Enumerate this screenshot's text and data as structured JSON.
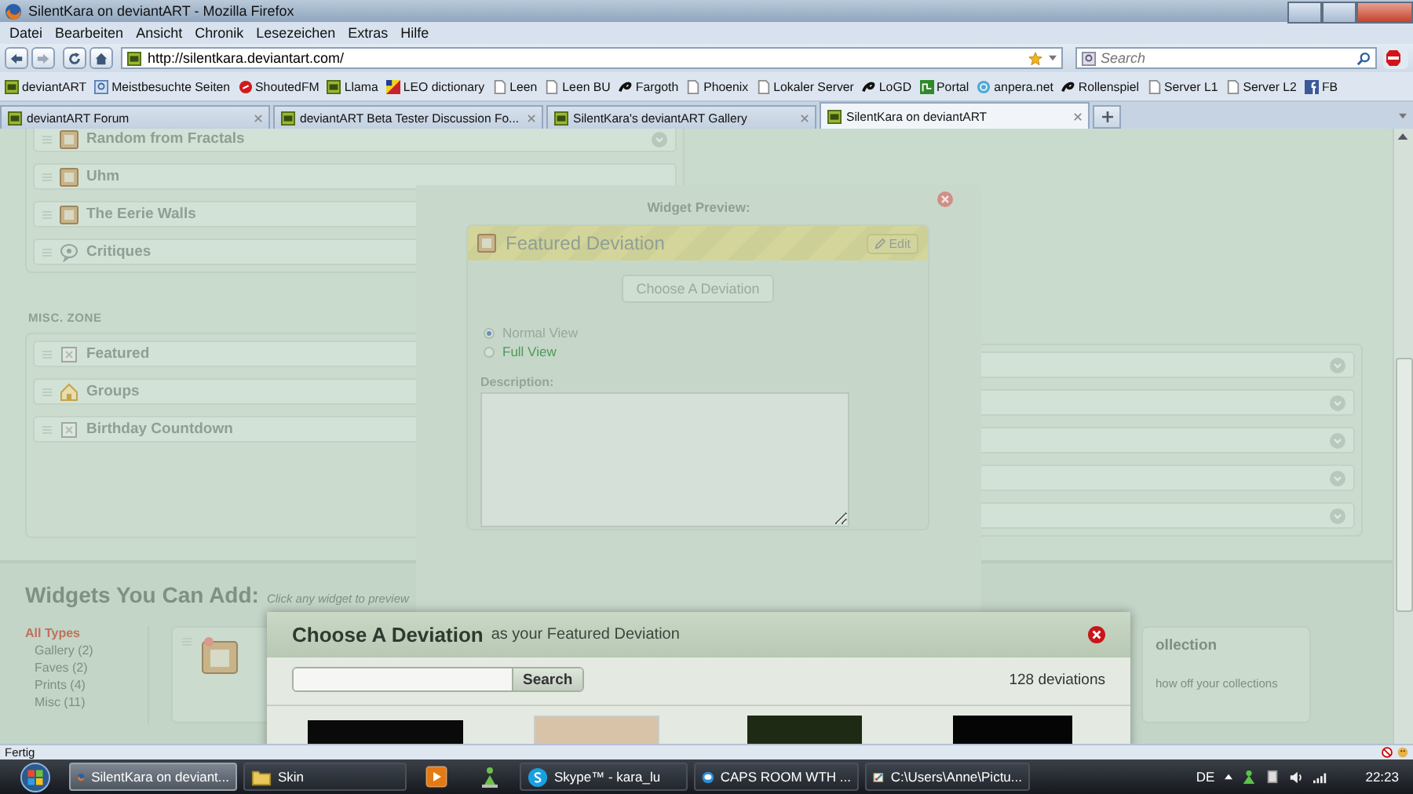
{
  "window": {
    "title": "SilentKara on deviantART - Mozilla Firefox"
  },
  "menu": [
    "Datei",
    "Bearbeiten",
    "Ansicht",
    "Chronik",
    "Lesezeichen",
    "Extras",
    "Hilfe"
  ],
  "address": {
    "url": "http://silentkara.deviantart.com/"
  },
  "search": {
    "placeholder": "Search"
  },
  "bookmarks": [
    "deviantART",
    "Meistbesuchte Seiten",
    "ShoutedFM",
    "Llama",
    "LEO dictionary",
    "Leen",
    "Leen BU",
    "Fargoth",
    "Phoenix",
    "Lokaler Server",
    "LoGD",
    "Portal",
    "anpera.net",
    "Rollenspiel",
    "Server L1",
    "Server L2",
    "FB"
  ],
  "tabs": [
    {
      "label": "deviantART Forum",
      "selected": false
    },
    {
      "label": "deviantART Beta Tester Discussion Fo...",
      "selected": false
    },
    {
      "label": "SilentKara's deviantART Gallery",
      "selected": false
    },
    {
      "label": "SilentKara on deviantART",
      "selected": true
    }
  ],
  "page": {
    "widgets": [
      "Random from Fractals",
      "Uhm",
      "The Eerie Walls",
      "Critiques"
    ],
    "zone_title": "MISC. ZONE",
    "misc_widgets": [
      "Featured",
      "Groups",
      "Birthday Countdown"
    ],
    "add_title": "Widgets You Can Add:",
    "add_hint": "Click any widget to preview",
    "types": [
      {
        "label": "All Types",
        "selected": true
      },
      {
        "label": "Gallery (2)",
        "selected": false
      },
      {
        "label": "Faves (2)",
        "selected": false
      },
      {
        "label": "Prints (4)",
        "selected": false
      },
      {
        "label": "Misc (11)",
        "selected": false
      }
    ],
    "collection_card": {
      "title": "ollection",
      "text": "how off your collections"
    }
  },
  "preview": {
    "title": "Widget Preview:",
    "widget_title": "Featured Deviation",
    "edit": "Edit",
    "choose": "Choose A Deviation",
    "views": [
      {
        "label": "Normal View",
        "selected": true
      },
      {
        "label": "Full View",
        "selected": false
      }
    ],
    "description_label": "Description:"
  },
  "picker": {
    "title": "Choose A Deviation",
    "subtitle": "as your Featured Deviation",
    "search_button": "Search",
    "count": "128 deviations"
  },
  "status": "Fertig",
  "taskbar": {
    "items": [
      {
        "kind": "window",
        "label": "SilentKara on deviant...",
        "selected": true
      },
      {
        "kind": "window",
        "label": "Skin",
        "selected": false
      },
      {
        "kind": "launcher"
      },
      {
        "kind": "launcher"
      },
      {
        "kind": "window",
        "label": "Skype™ - kara_lu",
        "selected": false
      },
      {
        "kind": "window",
        "label": "CAPS ROOM WTH ...",
        "selected": false
      },
      {
        "kind": "window",
        "label": "C:\\Users\\Anne\\Pictu...",
        "selected": false
      }
    ],
    "language": "DE",
    "clock": "22:23"
  }
}
